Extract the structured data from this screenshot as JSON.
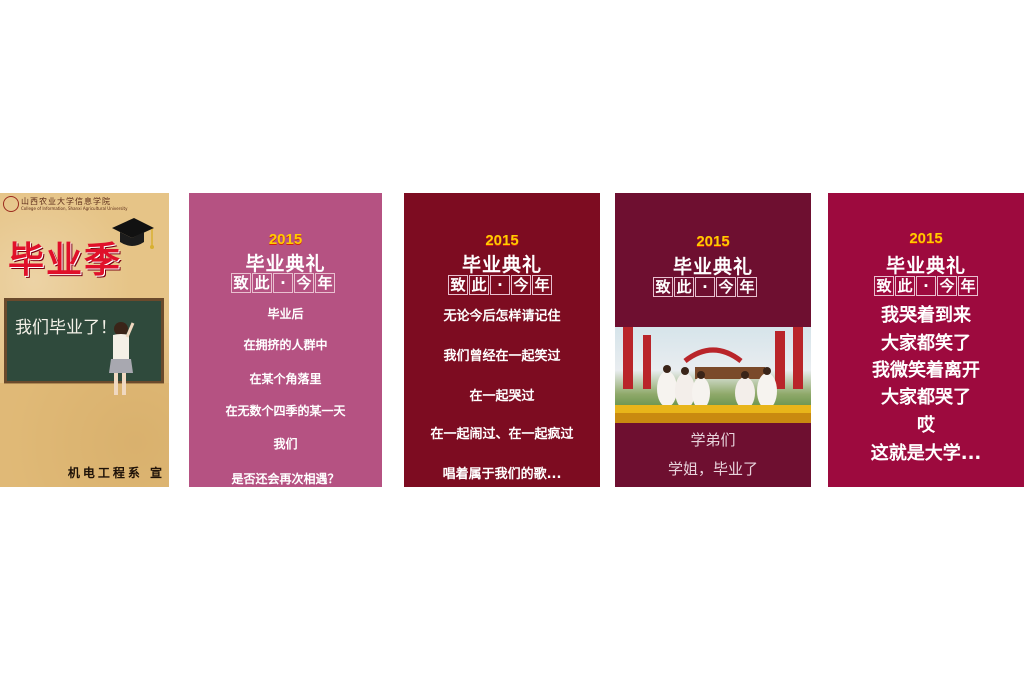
{
  "panel1": {
    "school": "山西农业大学信息学院",
    "school_en": "College of Information, Shanxi Agricultural University",
    "headline": "毕业季",
    "chalkboard": "我们毕业了！",
    "department": "机电工程系 宣"
  },
  "panel2": {
    "year": "2015",
    "title": "毕业典礼",
    "grid": [
      "致",
      "此",
      "·",
      "今",
      "年"
    ],
    "lines": [
      "毕业后",
      "在拥挤的人群中",
      "在某个角落里",
      "在无数个四季的某一天",
      "我们",
      "是否还会再次相遇？"
    ]
  },
  "panel3": {
    "year": "2015",
    "title": "毕业典礼",
    "grid": [
      "致",
      "此",
      "·",
      "今",
      "年"
    ],
    "lines": [
      "无论今后怎样请记住",
      "我们曾经在一起笑过",
      "在一起哭过",
      "在一起闹过、在一起疯过",
      "唱着属于我们的歌..."
    ]
  },
  "panel4": {
    "year": "2015",
    "title": "毕业典礼",
    "grid": [
      "致",
      "此",
      "·",
      "今",
      "年"
    ],
    "captions": [
      "学弟们",
      "学姐，毕业了"
    ]
  },
  "panel5": {
    "year": "2015",
    "title": "毕业典礼",
    "grid": [
      "致",
      "此",
      "·",
      "今",
      "年"
    ],
    "lines": [
      "我哭着到来",
      "大家都笑了",
      "我微笑着离开",
      "大家都哭了",
      "哎",
      "这就是大学..."
    ]
  },
  "colors": {
    "panel2_bg": "#b55282",
    "panel3_bg": "#7d0c21",
    "panel4_bg": "#6e0f30",
    "panel5_bg": "#9d0a3e",
    "year_gold": "#ffcc00",
    "headline_red": "#e0102a"
  }
}
